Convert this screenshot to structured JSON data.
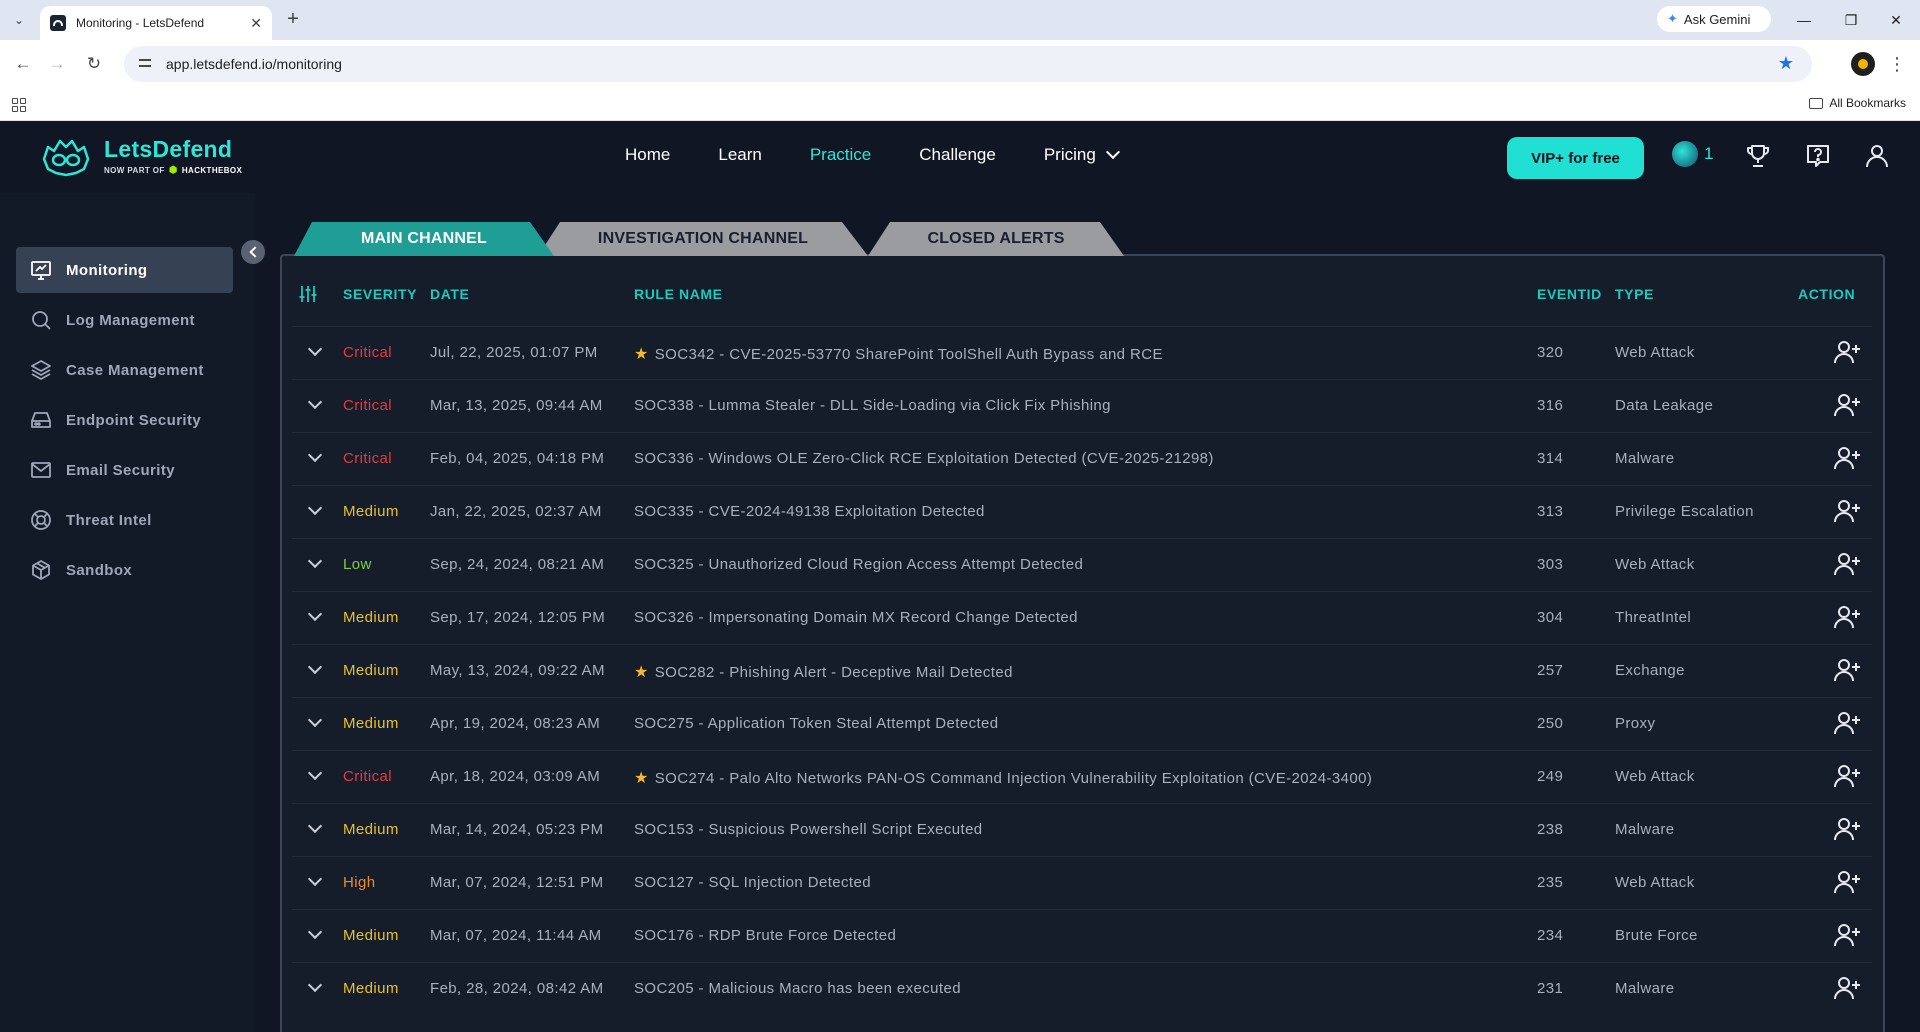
{
  "browser": {
    "tab_title": "Monitoring - LetsDefend",
    "url": "app.letsdefend.io/monitoring",
    "ask_gemini": "Ask Gemini",
    "all_bookmarks": "All Bookmarks"
  },
  "brand": {
    "name": "LetsDefend",
    "sub_prefix": "NOW PART OF",
    "sub_brand": "HACKTHEBOX",
    "accent_color": "#2ee6d6"
  },
  "nav": {
    "items": [
      {
        "label": "Home"
      },
      {
        "label": "Learn"
      },
      {
        "label": "Practice"
      },
      {
        "label": "Challenge"
      },
      {
        "label": "Pricing"
      }
    ],
    "vip_label": "VIP+ for free",
    "badge_count": "1"
  },
  "sidebar": {
    "items": [
      {
        "label": "Monitoring",
        "icon": "monitor-icon"
      },
      {
        "label": "Log Management",
        "icon": "search-icon"
      },
      {
        "label": "Case Management",
        "icon": "layers-icon"
      },
      {
        "label": "Endpoint Security",
        "icon": "hard-drive-icon"
      },
      {
        "label": "Email Security",
        "icon": "mail-icon"
      },
      {
        "label": "Threat Intel",
        "icon": "lifebuoy-icon"
      },
      {
        "label": "Sandbox",
        "icon": "box-icon"
      }
    ]
  },
  "channel_tabs": [
    {
      "label": "MAIN CHANNEL",
      "color": "#1e9e95"
    },
    {
      "label": "INVESTIGATION CHANNEL",
      "color": "#9a9ca0"
    },
    {
      "label": "CLOSED ALERTS",
      "color": "#9a9ca0"
    }
  ],
  "table": {
    "headers": {
      "severity": "SEVERITY",
      "date": "DATE",
      "rule_name": "RULE NAME",
      "eventid": "EVENTID",
      "type": "TYPE",
      "action": "ACTION"
    },
    "rows": [
      {
        "severity": "Critical",
        "date": "Jul, 22, 2025, 01:07 PM",
        "starred": true,
        "rule": "SOC342 - CVE-2025-53770 SharePoint ToolShell Auth Bypass and RCE",
        "eventid": "320",
        "type": "Web Attack"
      },
      {
        "severity": "Critical",
        "date": "Mar, 13, 2025, 09:44 AM",
        "starred": false,
        "rule": "SOC338 - Lumma Stealer - DLL Side-Loading via Click Fix Phishing",
        "eventid": "316",
        "type": "Data Leakage"
      },
      {
        "severity": "Critical",
        "date": "Feb, 04, 2025, 04:18 PM",
        "starred": false,
        "rule": "SOC336 - Windows OLE Zero-Click RCE Exploitation Detected (CVE-2025-21298)",
        "eventid": "314",
        "type": "Malware"
      },
      {
        "severity": "Medium",
        "date": "Jan, 22, 2025, 02:37 AM",
        "starred": false,
        "rule": "SOC335 - CVE-2024-49138 Exploitation Detected",
        "eventid": "313",
        "type": "Privilege Escalation"
      },
      {
        "severity": "Low",
        "date": "Sep, 24, 2024, 08:21 AM",
        "starred": false,
        "rule": "SOC325 - Unauthorized Cloud Region Access Attempt Detected",
        "eventid": "303",
        "type": "Web Attack"
      },
      {
        "severity": "Medium",
        "date": "Sep, 17, 2024, 12:05 PM",
        "starred": false,
        "rule": "SOC326 - Impersonating Domain MX Record Change Detected",
        "eventid": "304",
        "type": "ThreatIntel"
      },
      {
        "severity": "Medium",
        "date": "May, 13, 2024, 09:22 AM",
        "starred": true,
        "rule": "SOC282 - Phishing Alert - Deceptive Mail Detected",
        "eventid": "257",
        "type": "Exchange"
      },
      {
        "severity": "Medium",
        "date": "Apr, 19, 2024, 08:23 AM",
        "starred": false,
        "rule": "SOC275 - Application Token Steal Attempt Detected",
        "eventid": "250",
        "type": "Proxy"
      },
      {
        "severity": "Critical",
        "date": "Apr, 18, 2024, 03:09 AM",
        "starred": true,
        "rule": "SOC274 - Palo Alto Networks PAN-OS Command Injection Vulnerability Exploitation (CVE-2024-3400)",
        "eventid": "249",
        "type": "Web Attack"
      },
      {
        "severity": "Medium",
        "date": "Mar, 14, 2024, 05:23 PM",
        "starred": false,
        "rule": "SOC153 - Suspicious Powershell Script Executed",
        "eventid": "238",
        "type": "Malware"
      },
      {
        "severity": "High",
        "date": "Mar, 07, 2024, 12:51 PM",
        "starred": false,
        "rule": "SOC127 - SQL Injection Detected",
        "eventid": "235",
        "type": "Web Attack"
      },
      {
        "severity": "Medium",
        "date": "Mar, 07, 2024, 11:44 AM",
        "starred": false,
        "rule": "SOC176 - RDP Brute Force Detected",
        "eventid": "234",
        "type": "Brute Force"
      },
      {
        "severity": "Medium",
        "date": "Feb, 28, 2024, 08:42 AM",
        "starred": false,
        "rule": "SOC205 - Malicious Macro has been executed",
        "eventid": "231",
        "type": "Malware"
      }
    ]
  },
  "severity_colors": {
    "Critical": "#e8383d",
    "High": "#f08a24",
    "Medium": "#e8c12e",
    "Low": "#7ccf3a"
  }
}
